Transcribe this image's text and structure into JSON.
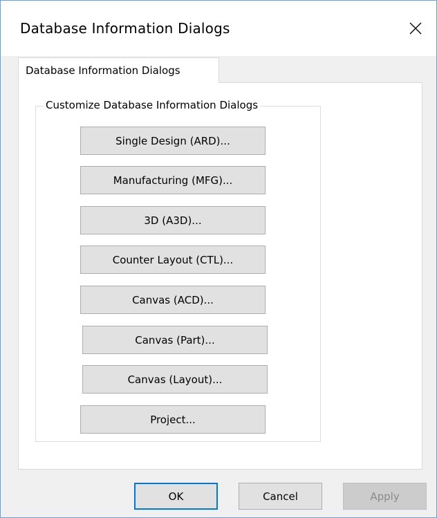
{
  "window": {
    "title": "Database Information Dialogs"
  },
  "tab": {
    "label": "Database Information Dialogs"
  },
  "group": {
    "label": "Customize Database Information Dialogs"
  },
  "buttons": [
    {
      "label": "Single Design (ARD)..."
    },
    {
      "label": "Manufacturing (MFG)..."
    },
    {
      "label": "3D (A3D)..."
    },
    {
      "label": "Counter Layout (CTL)..."
    },
    {
      "label": "Canvas (ACD)..."
    },
    {
      "label": "Canvas (Part)..."
    },
    {
      "label": "Canvas (Layout)..."
    },
    {
      "label": "Project..."
    }
  ],
  "footer": {
    "ok_label": "OK",
    "cancel_label": "Cancel",
    "apply_label": "Apply",
    "apply_enabled": false
  },
  "icons": {
    "close": "close-icon"
  },
  "colors": {
    "focus_border": "#0078d7",
    "window_border": "#6e9fd0",
    "button_face": "#e1e1e1",
    "dialog_background": "#f0f0f0"
  }
}
